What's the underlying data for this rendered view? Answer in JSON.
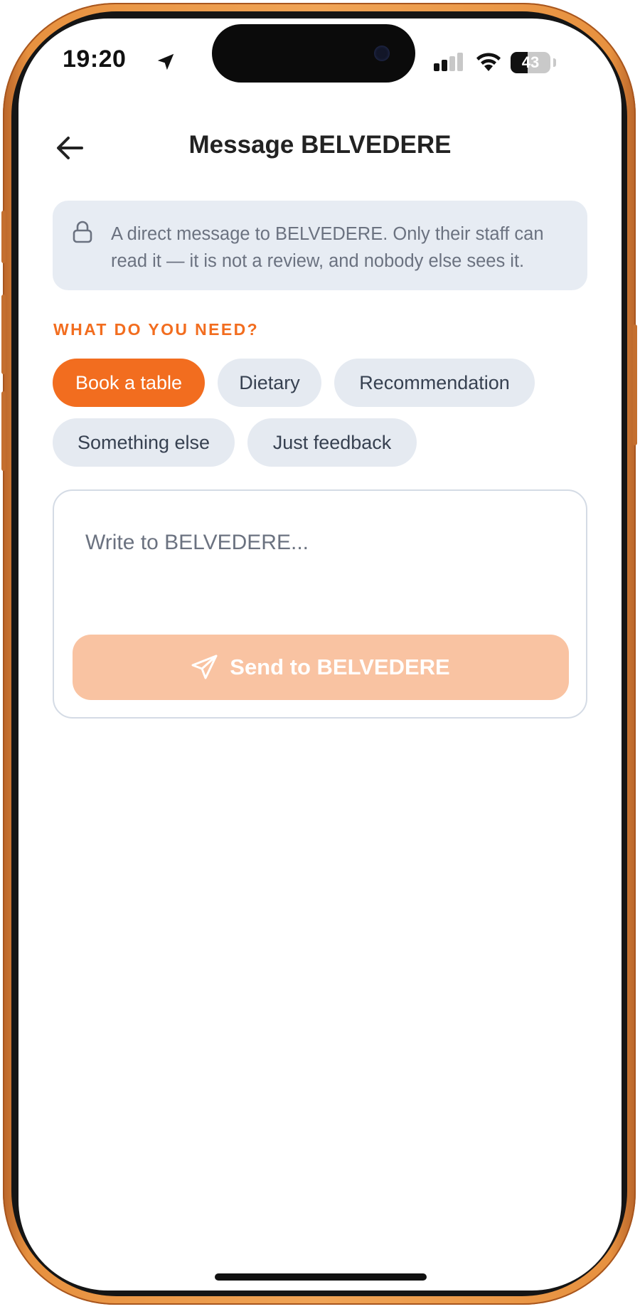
{
  "status_bar": {
    "time": "19:20",
    "battery": "43",
    "battery_level": 0.43,
    "icons": [
      "location-arrow-icon",
      "cellular-signal-icon",
      "wifi-icon",
      "battery-icon"
    ]
  },
  "header": {
    "title": "Message BELVEDERE",
    "back_icon": "arrow-left-icon"
  },
  "notice": {
    "icon": "lock-icon",
    "text": "A direct message to BELVEDERE. Only their staff can read it — it is not a review, and nobody else sees it."
  },
  "topics": {
    "label": "WHAT DO YOU NEED?",
    "chips": [
      {
        "label": "Book a table",
        "selected": true
      },
      {
        "label": "Dietary",
        "selected": false
      },
      {
        "label": "Recommendation",
        "selected": false
      },
      {
        "label": "Something else",
        "selected": false
      },
      {
        "label": "Just feedback",
        "selected": false
      }
    ]
  },
  "composer": {
    "placeholder": "Write to BELVEDERE...",
    "value": "",
    "send_label": "Send to BELVEDERE",
    "send_icon": "send-paper-plane-icon",
    "send_enabled": false
  },
  "colors": {
    "accent": "#F26D1F",
    "accent_disabled": "#F9C3A2",
    "chip_bg": "#E5EAF1",
    "notice_bg": "#E7ECF3",
    "frame": "#F0A456"
  }
}
